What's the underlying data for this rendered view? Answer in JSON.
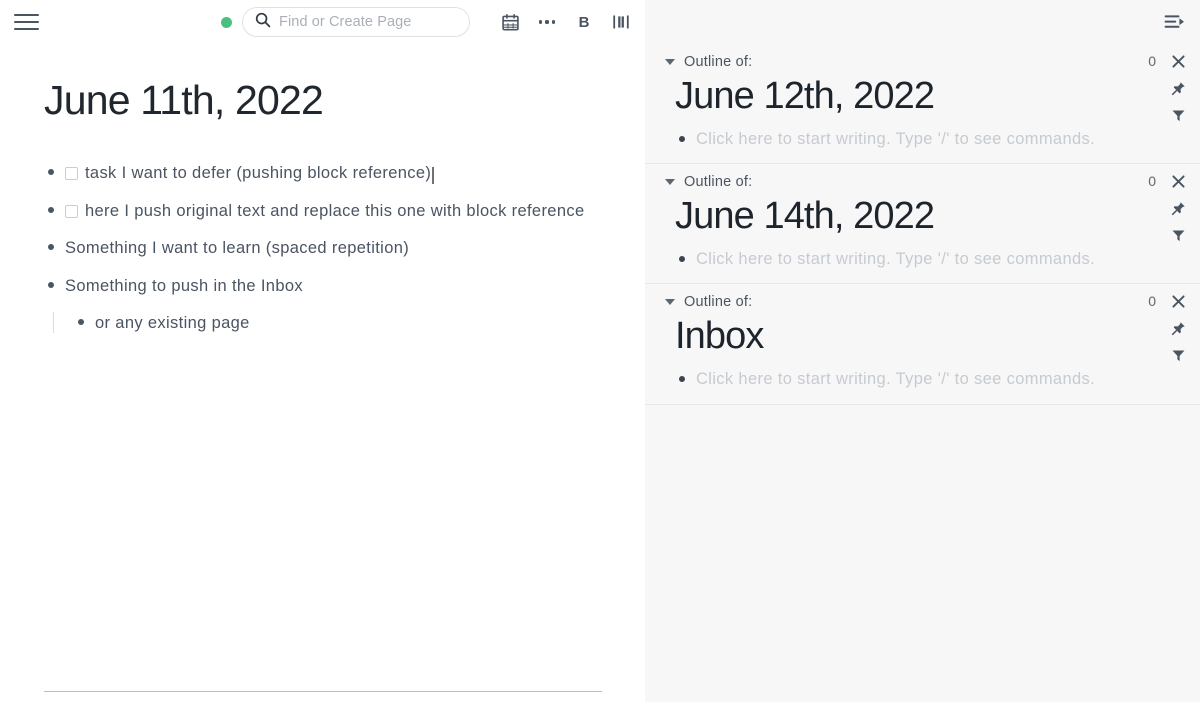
{
  "toolbar": {
    "menu_icon": "hamburger-menu-icon",
    "status_dot": "sync-status-dot",
    "status_color": "#49c07f",
    "search": {
      "placeholder": "Find or Create Page",
      "value": "",
      "icon": "search-icon"
    },
    "icons": [
      {
        "name": "calendar-icon",
        "label": "Journals"
      },
      {
        "name": "more-options-icon",
        "label": "•••"
      },
      {
        "name": "bold-b-icon",
        "label": "B"
      },
      {
        "name": "toggle-right-sidebar-icon",
        "label": "Toggle right sidebar"
      },
      {
        "name": "help-icon",
        "label": "?"
      }
    ]
  },
  "main": {
    "page_title": "June 11th, 2022",
    "blocks": [
      {
        "text": "task I want to defer (pushing block reference)",
        "checkbox": true,
        "checked": false,
        "has_cursor": true
      },
      {
        "text": "here I push original text and replace this one with block reference",
        "checkbox": true,
        "checked": false,
        "has_cursor": false
      },
      {
        "text": "Something I want to learn (spaced repetition)",
        "checkbox": false,
        "checked": false,
        "has_cursor": false
      },
      {
        "text": "Something to push in the Inbox",
        "checkbox": false,
        "checked": false,
        "has_cursor": false,
        "children": [
          {
            "text": "or any existing page",
            "checkbox": false
          }
        ]
      }
    ]
  },
  "right_sidebar": {
    "collapse_icon": "collapse-sidebar-icon",
    "item_label": "Outline of:",
    "placeholder": "Click here to start writing. Type '/' to see commands.",
    "controls": {
      "close_icon": "close-icon",
      "pin_icon": "pin-icon",
      "filter_icon": "filter-icon"
    },
    "items": [
      {
        "label": "Outline of:",
        "title": "June 12th, 2022",
        "count": "0"
      },
      {
        "label": "Outline of:",
        "title": "June 14th, 2022",
        "count": "0"
      },
      {
        "label": "Outline of:",
        "title": "Inbox",
        "count": "0"
      }
    ]
  },
  "colors": {
    "main_bg": "#ffffff",
    "sidebar_bg": "#f7f7f8",
    "text": "#4b5462",
    "title": "#21272e",
    "placeholder": "#c6cbd0",
    "accent_green": "#49c07f"
  }
}
